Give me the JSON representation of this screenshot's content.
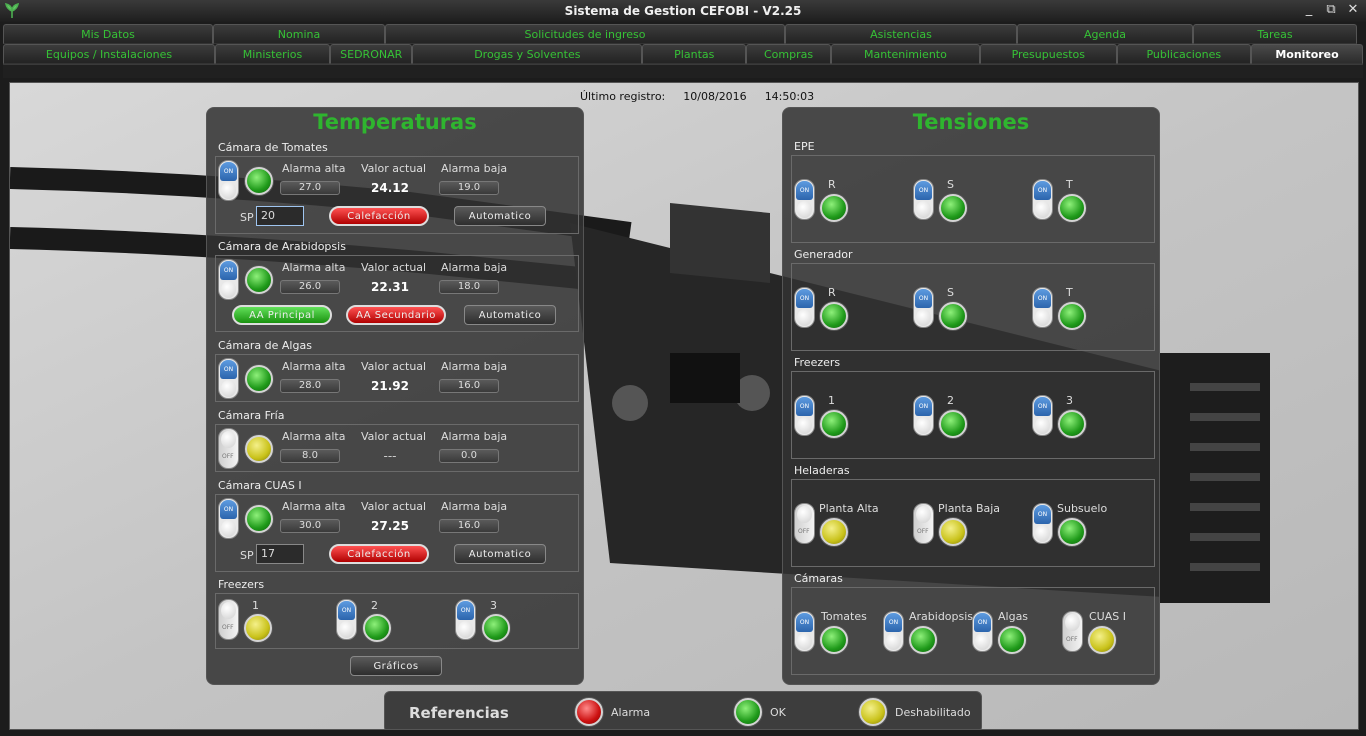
{
  "window": {
    "title": "Sistema de Gestion CEFOBI - V2.25"
  },
  "tabs_row1": [
    "Mis Datos",
    "Nomina",
    "Solicitudes de ingreso",
    "Asistencias",
    "Agenda",
    "Tareas"
  ],
  "tabs_row2": [
    "Equipos / Instalaciones",
    "Ministerios",
    "SEDRONAR",
    "Drogas y Solventes",
    "Plantas",
    "Compras",
    "Mantenimiento",
    "Presupuestos",
    "Publicaciones",
    "Monitoreo"
  ],
  "last_record": {
    "label": "Último registro:",
    "date": "10/08/2016",
    "time": "14:50:03"
  },
  "temperaturas": {
    "title": "Temperaturas",
    "headers": {
      "high": "Alarma alta",
      "current": "Valor actual",
      "low": "Alarma baja"
    },
    "chambers": [
      {
        "name": "Cámara de Tomates",
        "switch": "on",
        "status": "green",
        "high": "27.0",
        "current": "24.12",
        "low": "19.0",
        "sp_label": "SP",
        "sp": "20",
        "action": "Calefacción",
        "mode": "Automatico"
      },
      {
        "name": "Cámara de Arabidopsis",
        "switch": "on",
        "status": "green",
        "high": "26.0",
        "current": "22.31",
        "low": "18.0",
        "aa1": "AA Principal",
        "aa2": "AA Secundario",
        "mode": "Automatico"
      },
      {
        "name": "Cámara de Algas",
        "switch": "on",
        "status": "green",
        "high": "28.0",
        "current": "21.92",
        "low": "16.0"
      },
      {
        "name": "Cámara Fría",
        "switch": "off",
        "status": "yellow",
        "high": "8.0",
        "current": "---",
        "low": "0.0"
      },
      {
        "name": "Cámara CUAS I",
        "switch": "on",
        "status": "green",
        "high": "30.0",
        "current": "27.25",
        "low": "16.0",
        "sp_label": "SP",
        "sp": "17",
        "action": "Calefacción",
        "mode": "Automatico"
      }
    ],
    "freezers": {
      "label": "Freezers",
      "items": [
        {
          "label": "1",
          "switch": "off",
          "status": "yellow"
        },
        {
          "label": "2",
          "switch": "on",
          "status": "green"
        },
        {
          "label": "3",
          "switch": "on",
          "status": "green"
        }
      ]
    },
    "graphs_button": "Gráficos"
  },
  "tensiones": {
    "title": "Tensiones",
    "groups": [
      {
        "name": "EPE",
        "items": [
          {
            "label": "R",
            "switch": "on",
            "status": "green"
          },
          {
            "label": "S",
            "switch": "on",
            "status": "green"
          },
          {
            "label": "T",
            "switch": "on",
            "status": "green"
          }
        ]
      },
      {
        "name": "Generador",
        "items": [
          {
            "label": "R",
            "switch": "on",
            "status": "green"
          },
          {
            "label": "S",
            "switch": "on",
            "status": "green"
          },
          {
            "label": "T",
            "switch": "on",
            "status": "green"
          }
        ]
      },
      {
        "name": "Freezers",
        "items": [
          {
            "label": "1",
            "switch": "on",
            "status": "green"
          },
          {
            "label": "2",
            "switch": "on",
            "status": "green"
          },
          {
            "label": "3",
            "switch": "on",
            "status": "green"
          }
        ]
      },
      {
        "name": "Heladeras",
        "items": [
          {
            "label": "Planta Alta",
            "switch": "off",
            "status": "yellow"
          },
          {
            "label": "Planta Baja",
            "switch": "off",
            "status": "yellow"
          },
          {
            "label": "Subsuelo",
            "switch": "on",
            "status": "green"
          }
        ]
      },
      {
        "name": "Cámaras",
        "items": [
          {
            "label": "Tomates",
            "switch": "on",
            "status": "green"
          },
          {
            "label": "Arabidopsis",
            "switch": "on",
            "status": "green"
          },
          {
            "label": "Algas",
            "switch": "on",
            "status": "green"
          },
          {
            "label": "CUAS I",
            "switch": "off",
            "status": "yellow"
          }
        ]
      }
    ]
  },
  "referencias": {
    "title": "Referencias",
    "items": [
      {
        "label": "Alarma",
        "color": "red"
      },
      {
        "label": "OK",
        "color": "green"
      },
      {
        "label": "Deshabilitado",
        "color": "yellow"
      }
    ]
  },
  "toggle_text": {
    "on": "ON",
    "off": "OFF"
  },
  "window_controls": [
    "_",
    "⧉",
    "✕"
  ],
  "colors": {
    "accent_green": "#2fb52f",
    "tab_text": "#36c236"
  }
}
